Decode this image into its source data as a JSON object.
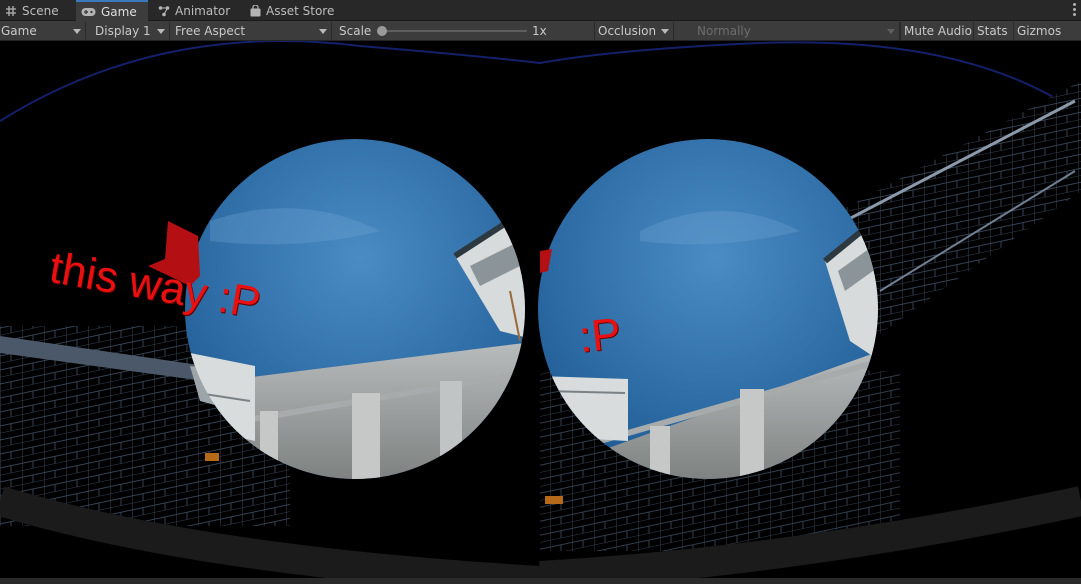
{
  "tabs": [
    {
      "label": "Scene",
      "icon": "grid-icon",
      "active": false
    },
    {
      "label": "Game",
      "icon": "gamepad-icon",
      "active": true
    },
    {
      "label": "Animator",
      "icon": "animator-icon",
      "active": false
    },
    {
      "label": "Asset Store",
      "icon": "shopping-bag-icon",
      "active": false
    }
  ],
  "toolbar": {
    "view_mode": "Game",
    "display": "Display 1",
    "aspect": "Free Aspect",
    "scale_label": "Scale",
    "scale_value": "1x",
    "scale_fraction": 0.0,
    "occlusion": "Occlusion M",
    "occlusion_mode": "Normally",
    "mute_audio": "Mute Audio",
    "stats": "Stats",
    "gizmos": "Gizmos"
  },
  "game": {
    "floor_text_left": "this way :P",
    "floor_text_right": ":P",
    "floor_text_color": "#e81010",
    "sky_color": "#2f6fa8"
  }
}
